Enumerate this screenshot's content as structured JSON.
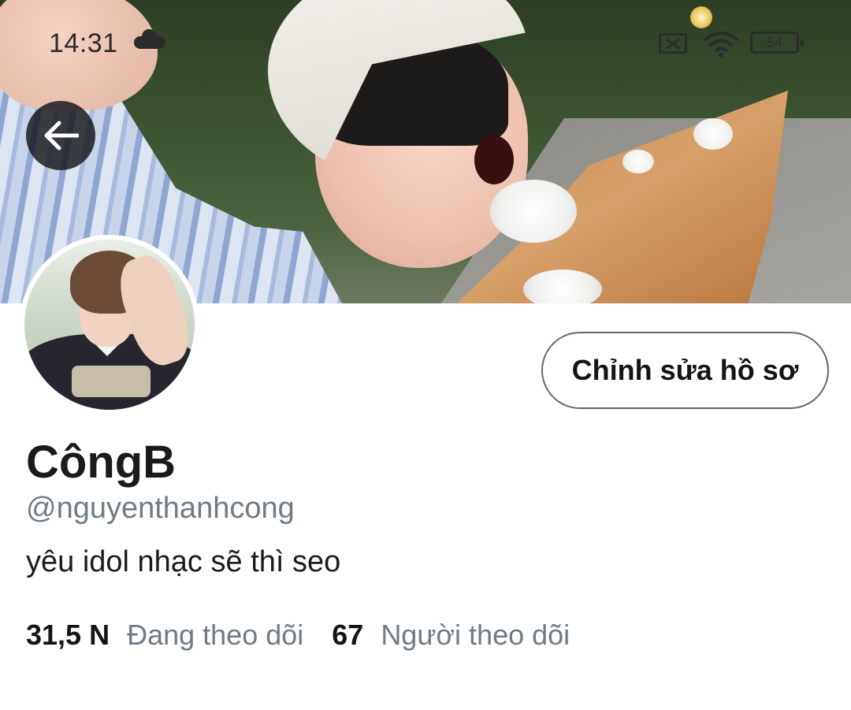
{
  "status_bar": {
    "time": "14:31",
    "battery": "54"
  },
  "profile": {
    "display_name": "CôngB",
    "handle": "@nguyenthanhcong",
    "bio": "yêu idol nhạc sẽ thì seo",
    "edit_button_label": "Chỉnh sửa hồ sơ"
  },
  "stats": {
    "following_count": "31,5 N",
    "following_label": "Đang theo dõi",
    "followers_count": "67",
    "followers_label": "Người theo dõi"
  },
  "icons": {
    "back": "arrow-left-icon",
    "status": [
      "cloud-icon",
      "sim-off-icon",
      "wifi-icon",
      "battery-icon"
    ]
  },
  "colors": {
    "text_primary": "#141414",
    "text_secondary": "#6f7b86",
    "button_border": "#5f6a73",
    "back_button_bg": "#141618"
  }
}
